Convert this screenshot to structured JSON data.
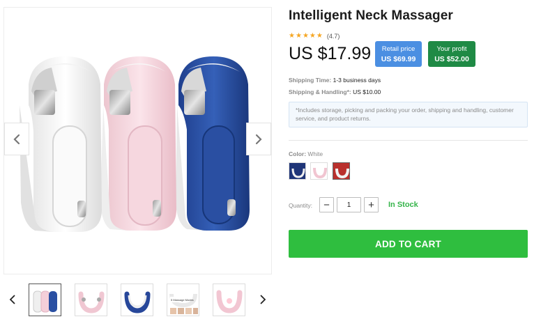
{
  "product": {
    "title": "Intelligent Neck Massager",
    "rating_stars": 5,
    "rating_value": "(4.7)",
    "price": "US $17.99",
    "retail": {
      "label": "Retail price",
      "value": "US $69.99",
      "color": "#4b8fe2"
    },
    "profit": {
      "label": "Your profit",
      "value": "US $52.00",
      "color": "#1f8a45"
    }
  },
  "shipping": {
    "time_label": "Shipping Time:",
    "time_value": "1-3 business days",
    "handling_label": "Shipping & Handling*:",
    "handling_value": "US $10.00",
    "note": "*Includes storage, picking and packing your order, shipping and handling, customer service, and product returns."
  },
  "color": {
    "label": "Color:",
    "selected": "White",
    "options": [
      "navy-swatch",
      "pink-swatch",
      "red-swatch"
    ]
  },
  "quantity": {
    "label": "Quantity:",
    "value": "1",
    "minus": "−",
    "plus": "+"
  },
  "stock_status": "In Stock",
  "cart": {
    "label": "ADD TO CART",
    "color": "#2fbe3f"
  },
  "gallery": {
    "thumb_count": 5,
    "thumbs": [
      "three-massagers-thumb",
      "pink-massager-thumb",
      "blue-massager-thumb",
      "modes-infographic-thumb",
      "pink-massager-glow-thumb"
    ],
    "thumb4_text": "5 Massage Modes"
  },
  "icons": {
    "prev": "chevron-left-icon",
    "next": "chevron-right-icon",
    "star": "★"
  }
}
